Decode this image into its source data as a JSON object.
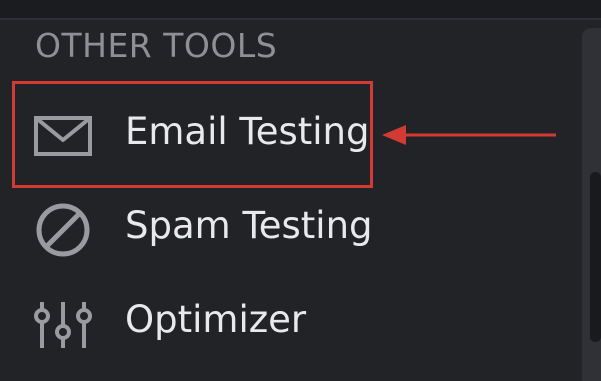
{
  "sidebar": {
    "section_title": "OTHER TOOLS",
    "items": [
      {
        "label": "Email Testing",
        "icon": "envelope-icon"
      },
      {
        "label": "Spam Testing",
        "icon": "prohibited-icon"
      },
      {
        "label": "Optimizer",
        "icon": "sliders-icon"
      }
    ]
  },
  "colors": {
    "background": "#222327",
    "text": "#e9e9ec",
    "section_title": "#8f9095",
    "icon": "#9a9ba0",
    "annotation": "#d23b33"
  }
}
